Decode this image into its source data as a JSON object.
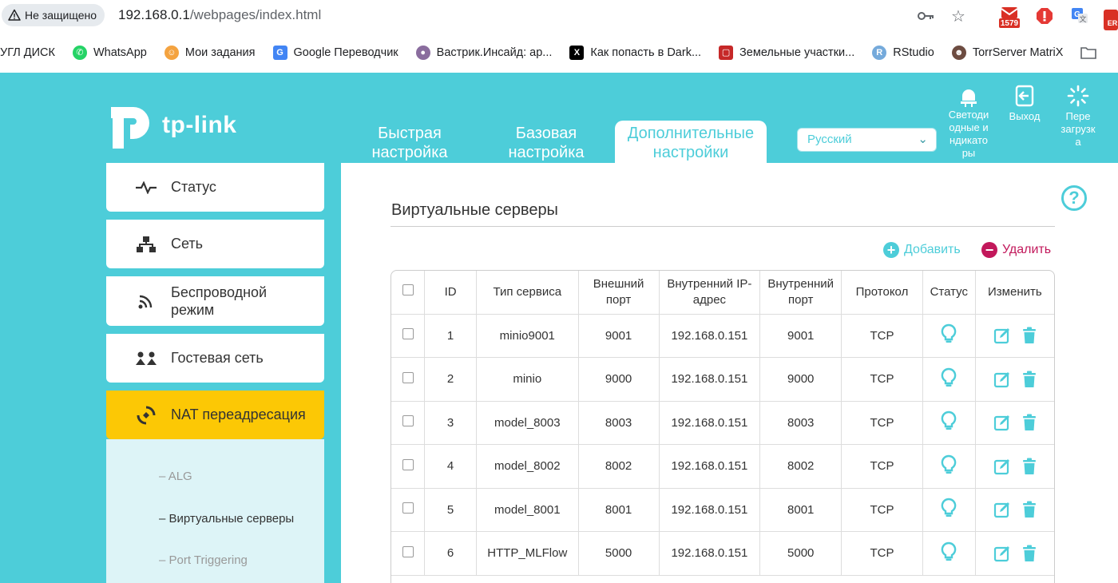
{
  "browser": {
    "security_label": "Не защищено",
    "url_host": "192.168.0.1",
    "url_path": "/webpages/index.html",
    "ext_badge": "1579",
    "bookmarks": [
      {
        "label": "УГЛ ДИСК",
        "icon": "none"
      },
      {
        "label": "WhatsApp",
        "icon": "whatsapp-icon"
      },
      {
        "label": "Мои задания",
        "icon": "tasks-icon"
      },
      {
        "label": "Google Переводчик",
        "icon": "google-translate-icon"
      },
      {
        "label": "Вастрик.Инсайд: ар...",
        "icon": "vastrik-icon"
      },
      {
        "label": "Как попасть в Dark...",
        "icon": "x-icon"
      },
      {
        "label": "Земельные участки...",
        "icon": "land-icon"
      },
      {
        "label": "RStudio",
        "icon": "rstudio-icon"
      },
      {
        "label": "TorrServer MatriX",
        "icon": "torrserver-icon"
      }
    ]
  },
  "header": {
    "logo_text": "tp-link",
    "tabs": [
      "Быстрая настройка",
      "Базовая настройка",
      "Дополнительные настройки"
    ],
    "language": "Русский",
    "top_buttons": [
      {
        "label": "Светоди одные и ндикато ры",
        "icon": "led-icon"
      },
      {
        "label": "Выход",
        "icon": "logout-icon"
      },
      {
        "label": "Пере загрузк а",
        "icon": "reboot-icon"
      }
    ]
  },
  "sidebar": {
    "items": [
      {
        "label": "Статус",
        "icon": "status-icon"
      },
      {
        "label": "Сеть",
        "icon": "network-icon"
      },
      {
        "label": "Беспроводной режим",
        "icon": "wireless-icon"
      },
      {
        "label": "Гостевая сеть",
        "icon": "guest-icon"
      },
      {
        "label": "NAT переадресация",
        "icon": "nat-icon"
      }
    ],
    "subitems": [
      "ALG",
      "Виртуальные серверы",
      "Port Triggering"
    ]
  },
  "main": {
    "title": "Виртуальные серверы",
    "add_label": "Добавить",
    "delete_label": "Удалить",
    "columns": [
      "ID",
      "Тип сервиса",
      "Внешний порт",
      "Внутренний IP-адрес",
      "Внутренний порт",
      "Протокол",
      "Статус",
      "Изменить"
    ],
    "rows": [
      {
        "id": "1",
        "service": "minio9001",
        "ext_port": "9001",
        "ip": "192.168.0.151",
        "int_port": "9001",
        "protocol": "TCP"
      },
      {
        "id": "2",
        "service": "minio",
        "ext_port": "9000",
        "ip": "192.168.0.151",
        "int_port": "9000",
        "protocol": "TCP"
      },
      {
        "id": "3",
        "service": "model_8003",
        "ext_port": "8003",
        "ip": "192.168.0.151",
        "int_port": "8003",
        "protocol": "TCP"
      },
      {
        "id": "4",
        "service": "model_8002",
        "ext_port": "8002",
        "ip": "192.168.0.151",
        "int_port": "8002",
        "protocol": "TCP"
      },
      {
        "id": "5",
        "service": "model_8001",
        "ext_port": "8001",
        "ip": "192.168.0.151",
        "int_port": "8001",
        "protocol": "TCP"
      },
      {
        "id": "6",
        "service": "HTTP_MLFlow",
        "ext_port": "5000",
        "ip": "192.168.0.151",
        "int_port": "5000",
        "protocol": "TCP"
      }
    ]
  },
  "colors": {
    "brand": "#4dcdd9",
    "active": "#fcc805",
    "delete": "#c2185b"
  }
}
